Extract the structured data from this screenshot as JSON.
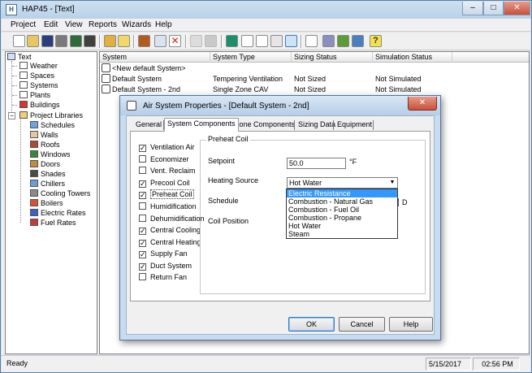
{
  "app": {
    "title": "HAP45 - [Text]"
  },
  "window_controls": {
    "minimize": "–",
    "maximize": "□",
    "close": "✕"
  },
  "menu": [
    "Project",
    "Edit",
    "View",
    "Reports",
    "Wizards",
    "Help"
  ],
  "tree": {
    "root": "Text",
    "items": [
      "Weather",
      "Spaces",
      "Systems",
      "Plants",
      "Buildings"
    ],
    "libraries": {
      "label": "Project Libraries",
      "expander": "−",
      "items": [
        "Schedules",
        "Walls",
        "Roofs",
        "Windows",
        "Doors",
        "Shades",
        "Chillers",
        "Cooling Towers",
        "Boilers",
        "Electric Rates",
        "Fuel Rates"
      ]
    }
  },
  "list": {
    "columns": [
      "System",
      "System Type",
      "Sizing Status",
      "Simulation Status"
    ],
    "rows": [
      {
        "system": "<New default System>",
        "type": "",
        "sizing": "",
        "simulation": ""
      },
      {
        "system": "Default System",
        "type": "Tempering Ventilation",
        "sizing": "Not Sized",
        "simulation": "Not Simulated"
      },
      {
        "system": "Default System - 2nd",
        "type": "Single Zone CAV",
        "sizing": "Not Sized",
        "simulation": "Not Simulated"
      }
    ]
  },
  "status": {
    "text": "Ready",
    "date": "5/15/2017",
    "time": "02:56 PM"
  },
  "dialog": {
    "title": "Air System Properties - [Default System - 2nd]",
    "close": "✕",
    "tabs": [
      "General",
      "System Components",
      "Zone Components",
      "Sizing Data",
      "Equipment"
    ],
    "components": [
      {
        "label": "Ventilation Air",
        "checked": true
      },
      {
        "label": "Economizer",
        "checked": false
      },
      {
        "label": "Vent. Reclaim",
        "checked": false
      },
      {
        "label": "Precool Coil",
        "checked": true
      },
      {
        "label": "Preheat Coil",
        "checked": true
      },
      {
        "label": "Humidification",
        "checked": false
      },
      {
        "label": "Dehumidification",
        "checked": false
      },
      {
        "label": "Central Cooling",
        "checked": true
      },
      {
        "label": "Central Heating",
        "checked": true
      },
      {
        "label": "Supply Fan",
        "checked": true
      },
      {
        "label": "Duct System",
        "checked": true
      },
      {
        "label": "Return Fan",
        "checked": false
      }
    ],
    "check_mark": "✓",
    "group_title": "Preheat Coil",
    "setpoint_label": "Setpoint",
    "setpoint_value": "50.0",
    "setpoint_unit": "°F",
    "heating_source_label": "Heating Source",
    "heating_source_value": "Hot Water",
    "combo_arrow": "▼",
    "heating_source_options": [
      "Electric Resistance",
      "Combustion - Natural Gas",
      "Combustion - Fuel Oil",
      "Combustion - Propane",
      "Hot Water",
      "Steam"
    ],
    "schedule_label": "Schedule",
    "schedule_fragment": "D",
    "coil_position_label": "Coil Position",
    "buttons": {
      "ok": "OK",
      "cancel": "Cancel",
      "help": "Help"
    }
  }
}
